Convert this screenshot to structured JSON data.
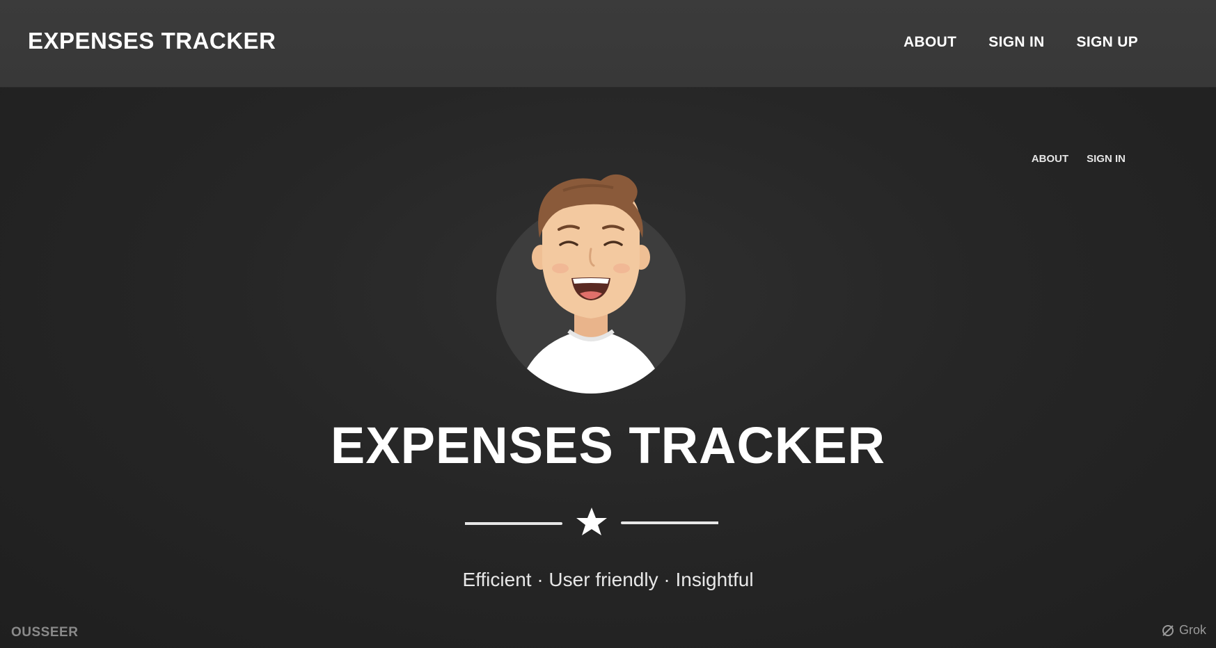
{
  "header": {
    "brand": "EXPENSES TRACKER",
    "nav": {
      "about": "ABOUT",
      "sign_in": "SIGN IN",
      "sign_up": "SIGN UP"
    }
  },
  "secondary_nav": {
    "about": "ABOUT",
    "sign_in": "SIGN IN"
  },
  "hero": {
    "avatar_icon": "smiling-person-avatar",
    "title": "EXPENSES TRACKER",
    "divider_icon": "star-icon",
    "tagline": "Efficient · User friendly · Insightful"
  },
  "footer": {
    "left_text": "OUSSEER",
    "watermark": "Grok",
    "watermark_icon": "grok-logo-icon"
  },
  "colors": {
    "header_bg": "#3a3a3a",
    "page_bg": "#262626",
    "text": "#ffffff",
    "avatar_circle": "#3d3d3d",
    "hair": "#8a5a3a",
    "skin": "#f3c9a0",
    "shirt": "#ffffff"
  }
}
